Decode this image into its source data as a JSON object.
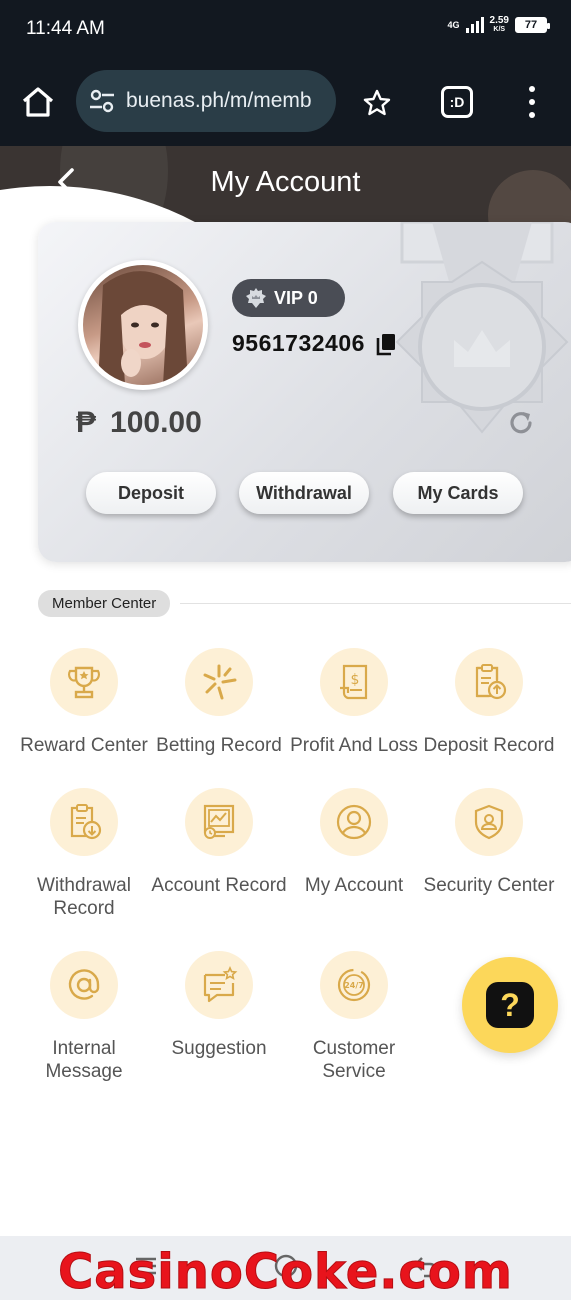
{
  "status_bar": {
    "time": "11:44 AM",
    "network": "4G",
    "speed": "2.59",
    "speed_unit": "K/S",
    "battery": "77"
  },
  "browser": {
    "url": "buenas.ph/m/memb",
    "icons": [
      "home-icon",
      "tune-icon",
      "star-icon",
      "tab-switcher-icon",
      "more-vert-icon"
    ],
    "tab_label": ":D"
  },
  "header": {
    "title": "My Account"
  },
  "account": {
    "vip_label": "VIP 0",
    "user_id": "9561732406",
    "currency_symbol": "₱",
    "balance": "100.00",
    "buttons": {
      "deposit": "Deposit",
      "withdrawal": "Withdrawal",
      "my_cards": "My Cards"
    }
  },
  "member_center": {
    "title": "Member Center",
    "items": [
      {
        "label": "Reward Center",
        "icon": "trophy-icon"
      },
      {
        "label": "Betting Record",
        "icon": "sparkle-icon"
      },
      {
        "label": "Profit And Loss",
        "icon": "receipt-dollar-icon"
      },
      {
        "label": "Deposit Record",
        "icon": "clipboard-upload-icon"
      },
      {
        "label": "Withdrawal Record",
        "icon": "clipboard-download-icon"
      },
      {
        "label": "Account Record",
        "icon": "monitor-chart-icon"
      },
      {
        "label": "My Account",
        "icon": "user-circle-icon"
      },
      {
        "label": "Security Center",
        "icon": "shield-user-icon"
      },
      {
        "label": "Internal Message",
        "icon": "at-sign-icon"
      },
      {
        "label": "Suggestion",
        "icon": "message-star-icon"
      },
      {
        "label": "Customer Service",
        "icon": "support-24-7-icon"
      }
    ]
  },
  "help_button": {
    "label": "?"
  },
  "watermark": "CasinoCoke.com",
  "colors": {
    "accent_gold": "#d9a94a",
    "icon_circle": "#fdf0d6",
    "help_yellow": "#fcd75a",
    "header_dark": "#3a3432",
    "watermark_red": "#e8141c"
  }
}
